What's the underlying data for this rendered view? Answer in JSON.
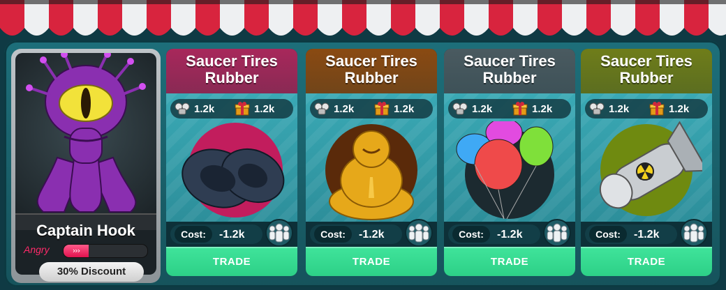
{
  "seller": {
    "name": "Captain Hook",
    "mood_label": "Angry",
    "mood_level": 0.3,
    "mood_arrows": "›››",
    "discount_label": "30% Discount"
  },
  "cards": [
    {
      "title_line1": "Saucer Tires",
      "title_line2": "Rubber",
      "stat_robot": "1.2k",
      "stat_gift": "1.2k",
      "cost_label": "Cost:",
      "cost_value": "-1.2k",
      "trade_label": "TRADE",
      "header_color": "#a8285b",
      "item": "tires"
    },
    {
      "title_line1": "Saucer Tires",
      "title_line2": "Rubber",
      "stat_robot": "1.2k",
      "stat_gift": "1.2k",
      "cost_label": "Cost:",
      "cost_value": "-1.2k",
      "trade_label": "TRADE",
      "header_color": "#8a4a12",
      "item": "golden-buddha"
    },
    {
      "title_line1": "Saucer Tires",
      "title_line2": "Rubber",
      "stat_robot": "1.2k",
      "stat_gift": "1.2k",
      "cost_label": "Cost:",
      "cost_value": "-1.2k",
      "trade_label": "TRADE",
      "header_color": "#4a5a60",
      "item": "balloons"
    },
    {
      "title_line1": "Saucer Tires",
      "title_line2": "Rubber",
      "stat_robot": "1.2k",
      "stat_gift": "1.2k",
      "cost_label": "Cost:",
      "cost_value": "-1.2k",
      "trade_label": "TRADE",
      "header_color": "#6f7d1a",
      "item": "nuclear-bomb"
    }
  ],
  "colors": {
    "awning_red": "#d8243e",
    "awning_white": "#eef0f2",
    "trade_green": "#2ccf86",
    "mood_pink": "#ff2a6a"
  }
}
